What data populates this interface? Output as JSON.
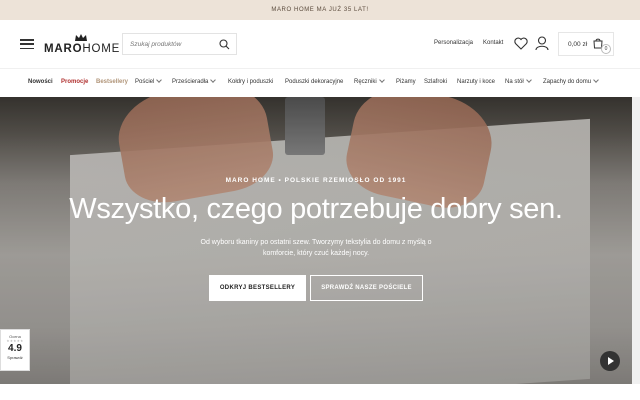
{
  "announcement": "MARO HOME MA JUŻ 35 LAT!",
  "logo": {
    "brand_bold": "MARO",
    "brand_light": "HOME"
  },
  "search": {
    "placeholder": "Szukaj produktów"
  },
  "header_links": {
    "personalization": "Personalizacja",
    "contact": "Kontakt"
  },
  "cart": {
    "amount": "0,00 zł",
    "count": "0"
  },
  "nav": {
    "items": [
      {
        "label": "Nowości",
        "style": "bold"
      },
      {
        "label": "Promocje",
        "style": "red"
      },
      {
        "label": "Bestsellery",
        "style": "tan"
      },
      {
        "label": "Pościel",
        "style": "dropdown"
      },
      {
        "label": "Prześcieradła",
        "style": "dropdown"
      },
      {
        "label": "Kołdry i poduszki",
        "style": "plain"
      },
      {
        "label": "Poduszki dekoracyjne",
        "style": "plain"
      },
      {
        "label": "Ręczniki",
        "style": "dropdown"
      },
      {
        "label": "Piżamy",
        "style": "plain"
      },
      {
        "label": "Szlafroki",
        "style": "plain"
      },
      {
        "label": "Narzuty i koce",
        "style": "plain"
      },
      {
        "label": "Na stół",
        "style": "dropdown"
      },
      {
        "label": "Zapachy do domu",
        "style": "dropdown"
      }
    ]
  },
  "hero": {
    "eyebrow": "MARO HOME • POLSKIE RZEMIOSŁO OD 1991",
    "title": "Wszystko, czego potrzebuje dobry sen.",
    "description": "Od wyboru tkaniny po ostatni szew. Tworzymy tekstylia do domu z myślą o komforcie, który czuć każdej nocy.",
    "cta_primary": "ODKRYJ BESTSELLERY",
    "cta_secondary": "SPRAWDŹ NASZE POŚCIELE"
  },
  "rating": {
    "header": "Ocena",
    "stars": "★★★★★",
    "score": "4.9",
    "footer": "Sprawdź"
  },
  "colors": {
    "topbar_bg": "#ede3d8",
    "promo": "#b0302f",
    "bestseller": "#b09478"
  }
}
